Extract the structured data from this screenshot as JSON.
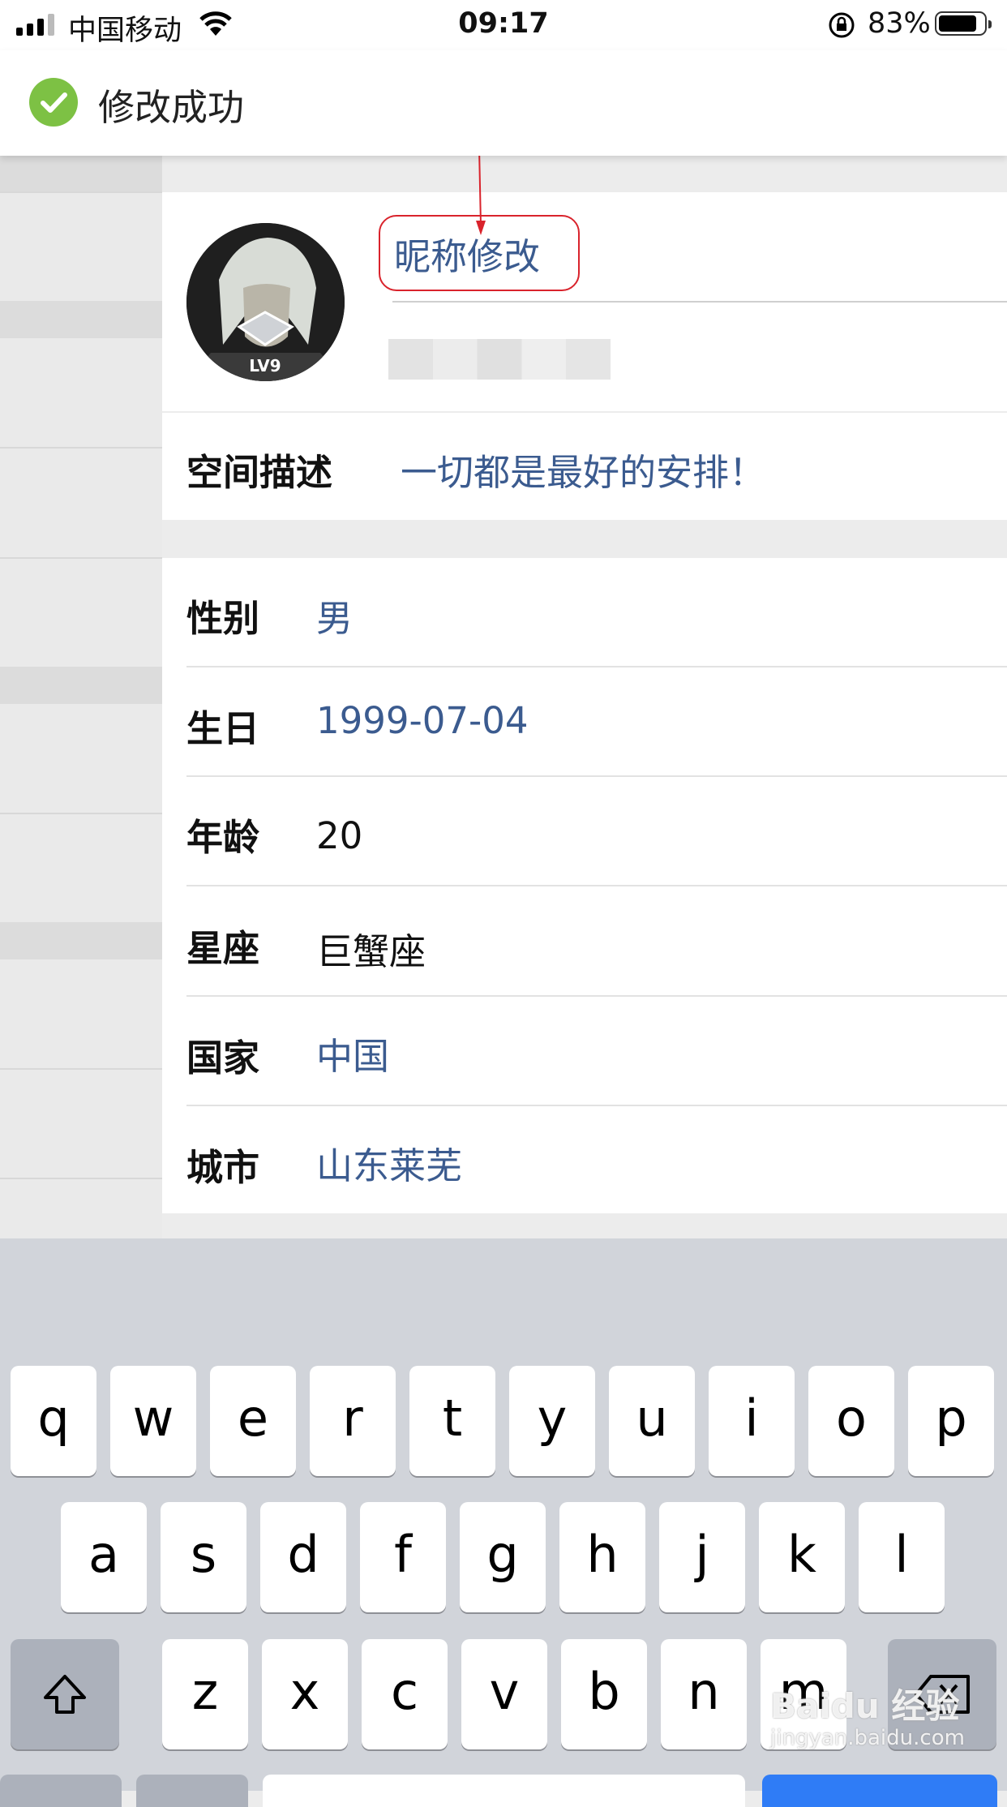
{
  "status_bar": {
    "carrier": "中国移动",
    "time": "09:17",
    "battery_percent": "83%",
    "battery_level": 0.83
  },
  "toast": {
    "message": "修改成功",
    "icon": "check-circle-icon",
    "accent": "#7dc144"
  },
  "profile": {
    "avatar_badge": "LV9",
    "nickname": "昵称修改",
    "highlight_color": "#d9232c"
  },
  "space_description": {
    "label": "空间描述",
    "value": "一切都是最好的安排！"
  },
  "fields": [
    {
      "label": "性别",
      "value": "男"
    },
    {
      "label": "生日",
      "value": "1999-07-04"
    },
    {
      "label": "年龄",
      "value": "20"
    },
    {
      "label": "星座",
      "value": "巨蟹座"
    },
    {
      "label": "国家",
      "value": "中国"
    },
    {
      "label": "城市",
      "value": "山东莱芜"
    }
  ],
  "keyboard": {
    "row1": [
      "q",
      "w",
      "e",
      "r",
      "t",
      "y",
      "u",
      "i",
      "o",
      "p"
    ],
    "row2": [
      "a",
      "s",
      "d",
      "f",
      "g",
      "h",
      "j",
      "k",
      "l"
    ],
    "row3": [
      "z",
      "x",
      "c",
      "v",
      "b",
      "n",
      "m"
    ],
    "shift_icon": "shift-icon",
    "delete_icon": "backspace-icon"
  },
  "watermark": {
    "brand": "Baidu 经验",
    "url": "jingyan.baidu.com"
  },
  "colors": {
    "link_blue": "#3b5b8f",
    "keyboard_bg": "#d1d4da"
  }
}
